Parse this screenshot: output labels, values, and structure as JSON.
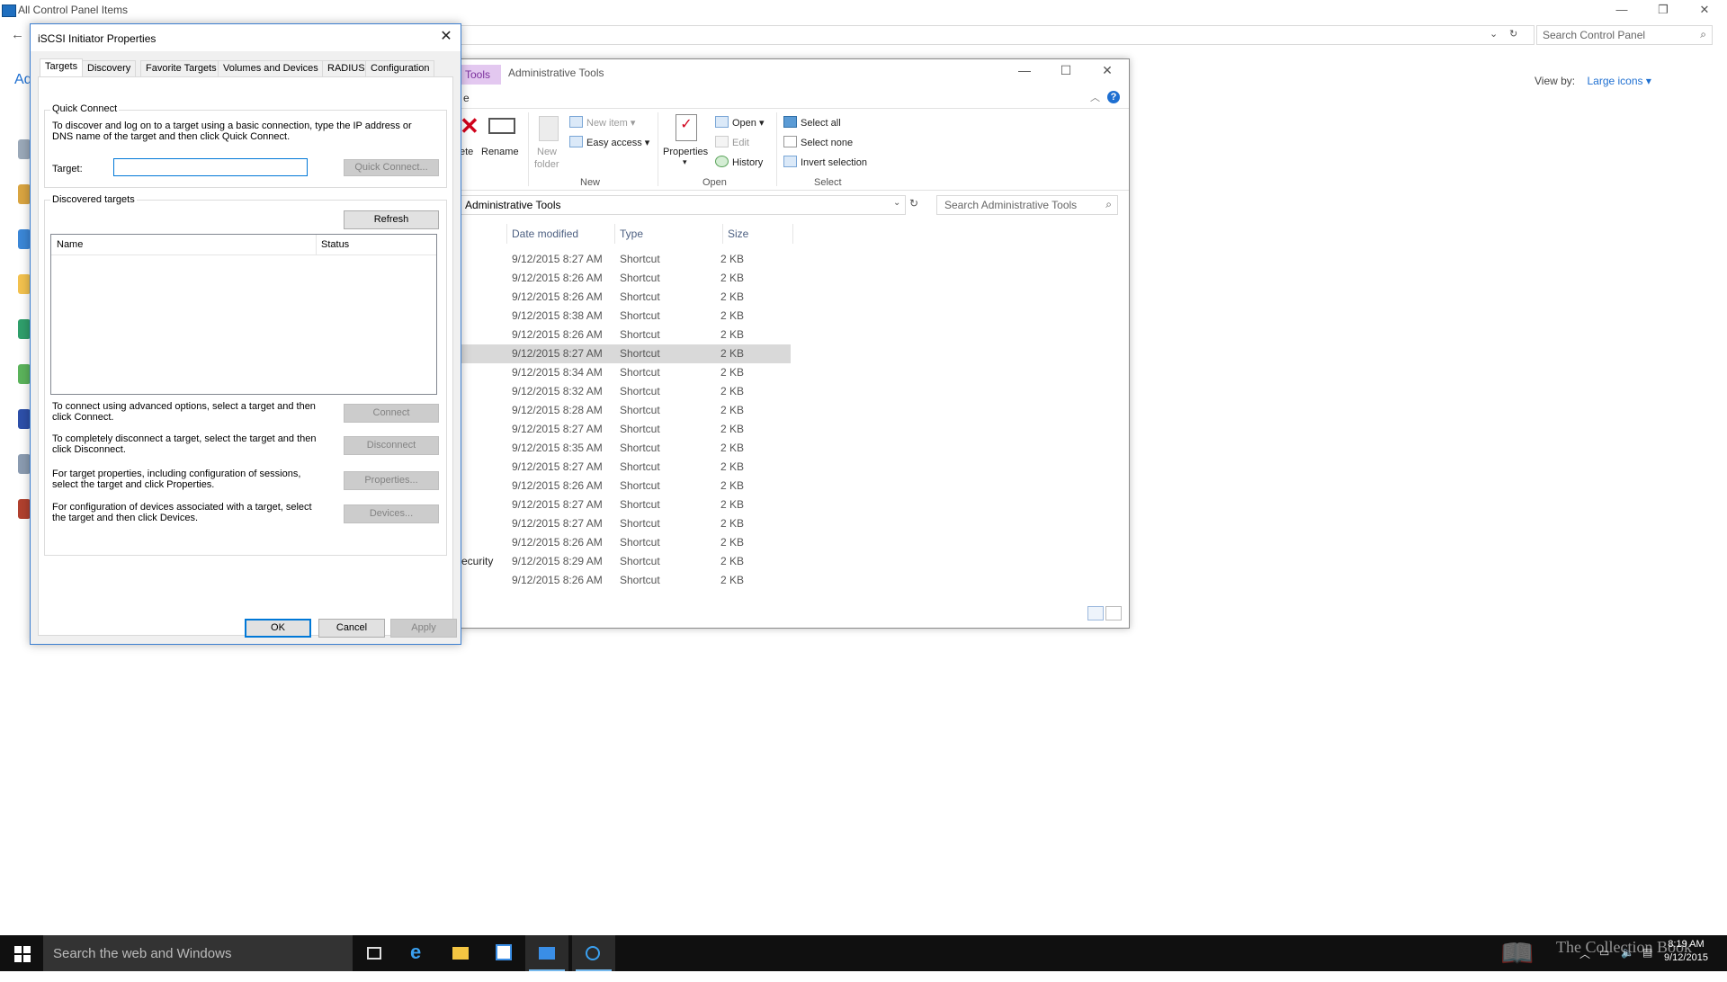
{
  "control_panel": {
    "title": "All Control Panel Items",
    "search_placeholder": "Search Control Panel",
    "view_by_label": "View by:",
    "view_by_value": "Large icons ▾",
    "left_partial": "Ad"
  },
  "explorer": {
    "ribbon_tab": "Tools",
    "title": "Administrative Tools",
    "subtab_partial": "e",
    "ribbon": {
      "delete_partial": "ete",
      "rename": "Rename",
      "new_folder_line1": "New",
      "new_folder_line2": "folder",
      "new_item": "New item ▾",
      "easy_access": "Easy access ▾",
      "properties": "Properties",
      "open": "Open ▾",
      "edit": "Edit",
      "history": "History",
      "select_all": "Select all",
      "select_none": "Select none",
      "invert_selection": "Invert selection",
      "group_new": "New",
      "group_open": "Open",
      "group_select": "Select"
    },
    "address": "Administrative Tools",
    "search_placeholder": "Search Administrative Tools",
    "columns": {
      "date": "Date modified",
      "type": "Type",
      "size": "Size"
    },
    "rows": [
      {
        "name": "",
        "date": "9/12/2015 8:27 AM",
        "type": "Shortcut",
        "size": "2 KB"
      },
      {
        "name": "",
        "date": "9/12/2015 8:26 AM",
        "type": "Shortcut",
        "size": "2 KB"
      },
      {
        "name": "",
        "date": "9/12/2015 8:26 AM",
        "type": "Shortcut",
        "size": "2 KB"
      },
      {
        "name": "",
        "date": "9/12/2015 8:38 AM",
        "type": "Shortcut",
        "size": "2 KB"
      },
      {
        "name": "",
        "date": "9/12/2015 8:26 AM",
        "type": "Shortcut",
        "size": "2 KB"
      },
      {
        "name": "",
        "date": "9/12/2015 8:27 AM",
        "type": "Shortcut",
        "size": "2 KB",
        "selected": true
      },
      {
        "name": "",
        "date": "9/12/2015 8:34 AM",
        "type": "Shortcut",
        "size": "2 KB"
      },
      {
        "name": "",
        "date": "9/12/2015 8:32 AM",
        "type": "Shortcut",
        "size": "2 KB"
      },
      {
        "name": "",
        "date": "9/12/2015 8:28 AM",
        "type": "Shortcut",
        "size": "2 KB"
      },
      {
        "name": "",
        "date": "9/12/2015 8:27 AM",
        "type": "Shortcut",
        "size": "2 KB"
      },
      {
        "name": "",
        "date": "9/12/2015 8:35 AM",
        "type": "Shortcut",
        "size": "2 KB"
      },
      {
        "name": "",
        "date": "9/12/2015 8:27 AM",
        "type": "Shortcut",
        "size": "2 KB"
      },
      {
        "name": "",
        "date": "9/12/2015 8:26 AM",
        "type": "Shortcut",
        "size": "2 KB"
      },
      {
        "name": "",
        "date": "9/12/2015 8:27 AM",
        "type": "Shortcut",
        "size": "2 KB"
      },
      {
        "name": "",
        "date": "9/12/2015 8:27 AM",
        "type": "Shortcut",
        "size": "2 KB"
      },
      {
        "name": "",
        "date": "9/12/2015 8:26 AM",
        "type": "Shortcut",
        "size": "2 KB"
      },
      {
        "name": "ecurity",
        "date": "9/12/2015 8:29 AM",
        "type": "Shortcut",
        "size": "2 KB"
      },
      {
        "name": "",
        "date": "9/12/2015 8:26 AM",
        "type": "Shortcut",
        "size": "2 KB"
      }
    ]
  },
  "dialog": {
    "title": "iSCSI Initiator Properties",
    "tabs": [
      "Targets",
      "Discovery",
      "Favorite Targets",
      "Volumes and Devices",
      "RADIUS",
      "Configuration"
    ],
    "active_tab": "Targets",
    "quick_connect": {
      "legend": "Quick Connect",
      "description": "To discover and log on to a target using a basic connection, type the IP address or DNS name of the target and then click Quick Connect.",
      "target_label": "Target:",
      "target_value": "",
      "quick_connect_button": "Quick Connect..."
    },
    "discovered": {
      "legend": "Discovered targets",
      "refresh_button": "Refresh",
      "columns": [
        "Name",
        "Status"
      ]
    },
    "actions": [
      {
        "text": "To connect using advanced options, select a target and then click Connect.",
        "button": "Connect"
      },
      {
        "text": "To completely disconnect a target, select the target and then click Disconnect.",
        "button": "Disconnect"
      },
      {
        "text": "For target properties, including configuration of sessions, select the target and click Properties.",
        "button": "Properties..."
      },
      {
        "text": "For configuration of devices associated with a target, select the target and then click Devices.",
        "button": "Devices..."
      }
    ],
    "buttons": {
      "ok": "OK",
      "cancel": "Cancel",
      "apply": "Apply"
    }
  },
  "taskbar": {
    "search_placeholder": "Search the web and Windows",
    "watermark": "The Collection Book",
    "time": "8:19 AM",
    "date": "9/12/2015"
  },
  "colors": {
    "accent": "#0078d7",
    "link": "#1e6fd1",
    "taskbar": "#101010",
    "tools_tab": "#e3c8f0"
  }
}
